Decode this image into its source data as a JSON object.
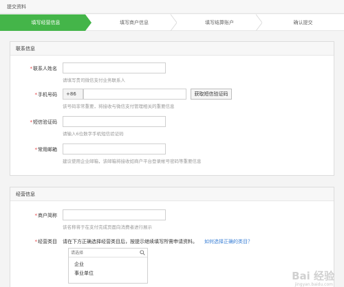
{
  "page": {
    "title": "提交资料"
  },
  "steps": [
    {
      "label": "填写经营信息",
      "active": true
    },
    {
      "label": "填写商户信息",
      "active": false
    },
    {
      "label": "填写结算账户",
      "active": false
    },
    {
      "label": "确认提交",
      "active": false
    }
  ],
  "contact": {
    "title": "联系信息",
    "name": {
      "label": "联系人姓名",
      "hint": "请填写贵司微信支付业务联系人"
    },
    "phone": {
      "label": "手机号码",
      "prefix": "+86",
      "button": "获取短信验证码",
      "hint": "该号码非常重要，将接收与微信支付管理相关的重要信息"
    },
    "sms": {
      "label": "短信验证码",
      "hint": "请输入6位数字手机短信验证码"
    },
    "email": {
      "label": "常用邮箱",
      "hint": "建议使用企业邮箱，该邮箱将接收如商户平台登录帐号密码等重要信息"
    }
  },
  "business": {
    "title": "经营信息",
    "shortname": {
      "label": "商户简称",
      "hint": "该名称将于在支付完成页面向消费者进行展示"
    },
    "category": {
      "label": "经营类目",
      "desc": "请在下方正确选择经营类目后，按提示继续填写所需申请资料。",
      "help_link": "如何选择正确的类目？",
      "search_placeholder": "请选择",
      "options": [
        "企业",
        "事业单位"
      ]
    }
  },
  "watermark": {
    "main": "Bai 经验",
    "sub": "jingyan.baidu.com"
  },
  "colors": {
    "active_step": "#44b549",
    "required": "#e4393c",
    "link": "#3a7fd5"
  },
  "icons": {
    "search": "search-icon",
    "step_arrow": "chevron-arrow"
  }
}
